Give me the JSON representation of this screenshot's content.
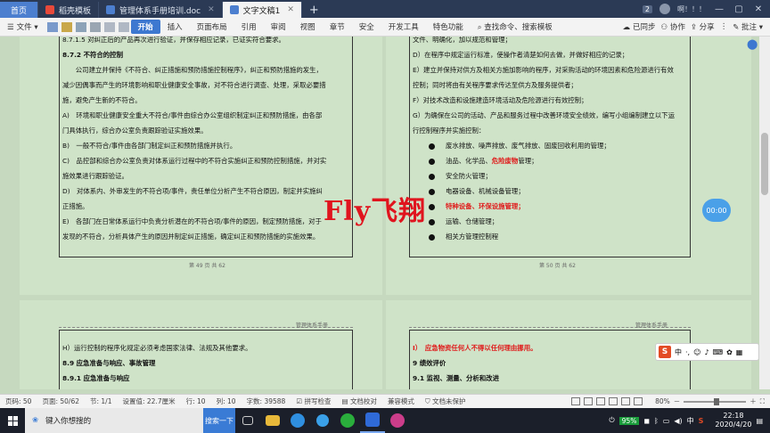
{
  "tabs": [
    {
      "label": "首页",
      "type": "home"
    },
    {
      "label": "稻壳模板",
      "type": "normal"
    },
    {
      "label": "管理体系手册培训.doc",
      "type": "normal"
    },
    {
      "label": "文字文稿1",
      "type": "active"
    }
  ],
  "tabbar": {
    "count_badge": "2",
    "user": "啊！！！"
  },
  "menu": {
    "file": "文件",
    "items": [
      "开始",
      "插入",
      "页面布局",
      "引用",
      "审阅",
      "视图",
      "章节",
      "安全",
      "开发工具",
      "特色功能"
    ],
    "search": "查找命令、搜索模板",
    "sync": "已同步",
    "collab": "协作",
    "share": "分享",
    "comment": "批注"
  },
  "page1": {
    "lines": [
      "8.7.1.5 对纠正后的产品再次进行验证，并保存相应记录，已证实符合要求。",
      "8.7.2 不符合的控制",
      "　　公司建立并保持《不符合、纠正措施和预防措施控制程序》，纠正和预防措施的发生，",
      "减少因偶事而产生的环境影响和职业健康安全事故，对不符合进行调查、处理，采取必要措",
      "施，避免产生新的不符合。",
      "A)　环境和职业健康安全重大不符合/事件由综合办公室组织制定纠正和预防措施，由各部",
      "门具体执行，综合办公室负责跟踪验证实施效果。",
      "B)　一般不符合/事件由各部门制定纠正和预防措施并执行。",
      "C)　品控部和综合办公室负责对体系运行过程中的不符合实施纠正和预防控制措施，并对实",
      "施效果进行跟踪验证。",
      "D)　对体系内、外审发生的不符合项/事件，责任单位分析产生不符合原因，制定并实施纠",
      "正措施。",
      "E)　各部门在日常体系运行中负责分析潜在的不符合项/事件的原因，制定预防措施，对于",
      "发现的不符合，分析具体产生的原因并制定纠正措施，确定纠正和预防措施的实施效果。"
    ],
    "page_number": "第 49 页 共 62"
  },
  "page2": {
    "lines": [
      "文件、明确化，加以规范和管理；",
      "D）在程序中规定运行标准，使操作者清楚如何去做，并做好相应的记录；",
      "E）建立并保持对供方及相关方施加影响的程序，对采购活动的环境因素和危险源进行有效",
      "控制；同时将由有关程序要求传达至供方及服务提供者；",
      "F）对技术改造和设施建造环境活动及危险源进行有效控制；",
      "G）为确保在公司的活动、产品和服务过程中改善环境安全绩效，编写小组编制建立以下运",
      "行控制程序并实施控制："
    ],
    "bullets": [
      {
        "text": "废水排放、噪声排放、废气排放、固废回收利用的管理；",
        "red": ""
      },
      {
        "text": "油品、化学品、",
        "red": "危险废物",
        "suffix": "管理；"
      },
      {
        "text": "安全防火管理；",
        "red": ""
      },
      {
        "text": "电器设备、机械设备管理；",
        "red": ""
      },
      {
        "text": "",
        "red": "特种设备、环保设施管理；"
      },
      {
        "text": "运输、仓储管理；",
        "red": ""
      },
      {
        "text": "相关方管理控制程",
        "red": ""
      }
    ],
    "page_number": "第 50 页 共 62"
  },
  "page3": {
    "header": "管理体系手册",
    "lines": [
      "H）运行控制的程序化规定必须考虑国家法律、法规及其他要求。",
      "8.9 应急准备与响应、事故管理",
      "8.9.1 应急准备与响应"
    ]
  },
  "page4": {
    "header": "管理体系手册",
    "lines": [
      "I）　应急物资任何人不得以任何理由挪用。",
      "9 绩效评价",
      "9.1 监视、测量、分析和改进"
    ]
  },
  "watermark": "Fly飞翔",
  "timer": "00:00",
  "ime": {
    "logo": "S",
    "lang": "中"
  },
  "status": {
    "page": "页码: 50",
    "pages": "页面: 50/62",
    "section": "节: 1/1",
    "setting": "设置值: 22.7厘米",
    "row": "行: 10",
    "col": "列: 10",
    "words": "字数: 39588",
    "spell": "拼写检查",
    "proof": "文档校对",
    "compat": "兼容模式",
    "unprotected": "文档未保护",
    "zoom": "80%"
  },
  "taskbar": {
    "search_placeholder": "键入你想搜的",
    "search_button": "搜索一下",
    "battery": "95%",
    "ime": "中",
    "time": "22:18",
    "date": "2020/4/20"
  }
}
